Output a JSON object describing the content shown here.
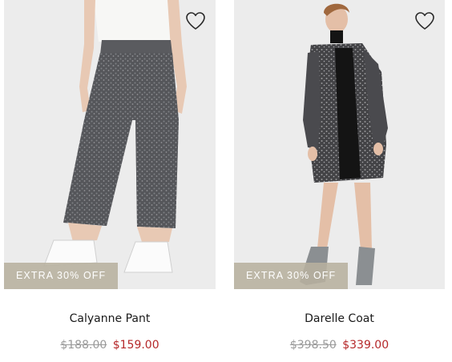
{
  "products": [
    {
      "name": "Calyanne Pant",
      "badge": "EXTRA 30% OFF",
      "original_price": "$188.00",
      "sale_price": "$159.00",
      "image_description": "model wearing grey marled knit cropped pants with white sneakers",
      "wishlist_icon": "heart-outline-icon"
    },
    {
      "name": "Darelle Coat",
      "badge": "EXTRA 30% OFF",
      "original_price": "$398.50",
      "sale_price": "$339.00",
      "image_description": "model wearing grey tweed coat over black dress with grey ankle boots",
      "wishlist_icon": "heart-outline-icon"
    }
  ],
  "colors": {
    "badge_bg": "#b7b09e",
    "sale_price": "#b5282a",
    "original_price": "#9a9a9a",
    "image_bg": "#ececec"
  }
}
